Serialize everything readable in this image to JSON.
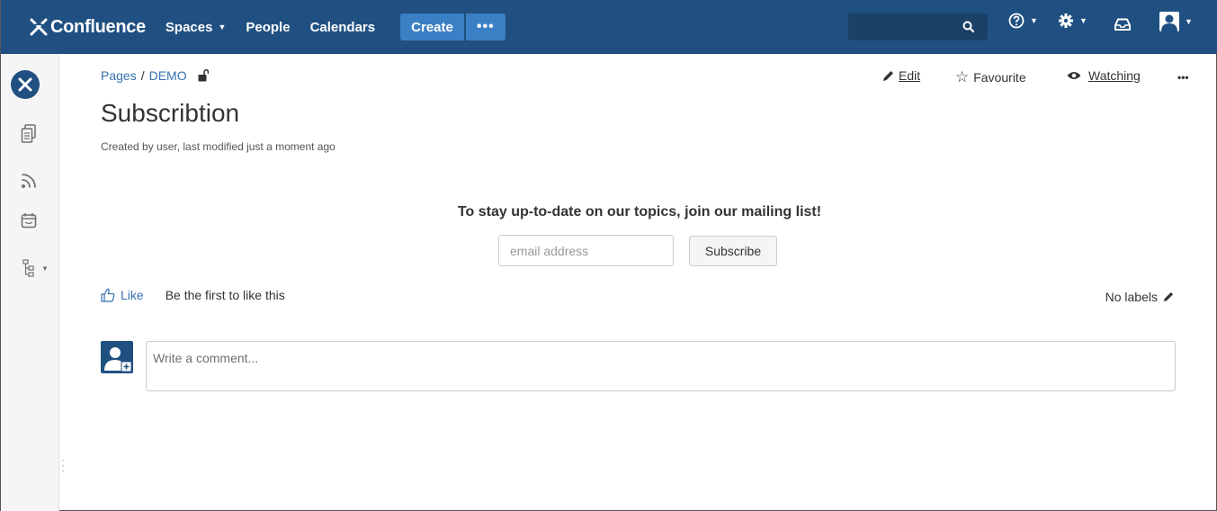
{
  "topnav": {
    "logo_text": "Confluence",
    "items": [
      {
        "label": "Spaces",
        "has_dropdown": true
      },
      {
        "label": "People",
        "has_dropdown": false
      },
      {
        "label": "Calendars",
        "has_dropdown": false
      }
    ],
    "create_label": "Create",
    "more_label": "•••",
    "background": "#205081",
    "accent": "#3b7fc4"
  },
  "breadcrumb": {
    "pages_label": "Pages",
    "separator": "/",
    "space_label": "DEMO"
  },
  "page": {
    "title": "Subscribtion",
    "byline": "Created by user, last modified just a moment ago"
  },
  "actions": {
    "edit_label": "Edit",
    "favourite_label": "Favourite",
    "watching_label": "Watching",
    "more_label": "•••"
  },
  "content": {
    "cta_text": "To stay up-to-date on our topics, join our mailing list!",
    "email_placeholder": "email address",
    "subscribe_label": "Subscribe"
  },
  "footer": {
    "like_label": "Like",
    "like_text": "Be the first to like this",
    "labels_text": "No labels"
  },
  "comment": {
    "placeholder": "Write a comment..."
  },
  "colors": {
    "link": "#3572b0",
    "sidebar_bg": "#f5f5f5"
  }
}
